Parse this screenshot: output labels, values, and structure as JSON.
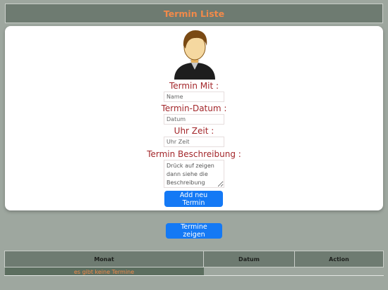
{
  "header": {
    "title": "Termin Liste"
  },
  "form": {
    "avatar_icon": "user-avatar-icon",
    "label_with": "Termin Mit :",
    "placeholder_name": "Name",
    "label_date": "Termin-Datum :",
    "placeholder_date": "Datum",
    "label_time": "Uhr Zeit :",
    "placeholder_time": "Uhr Zeit",
    "label_description": "Termin Beschreibung :",
    "placeholder_description": "Drück auf zeigen dann siehe die Beschreibung",
    "add_button": "Add neu Termin"
  },
  "show_button": "Termine zeigen",
  "table": {
    "headers": [
      "Monat",
      "Datum",
      "Action"
    ],
    "empty_message": "es gibt keine Termine"
  },
  "colors": {
    "background": "#9ea79f",
    "header_bg": "#6e7b71",
    "title_color": "#f28a4a",
    "label_color": "#a3262a",
    "button_bg": "#1479f5"
  }
}
